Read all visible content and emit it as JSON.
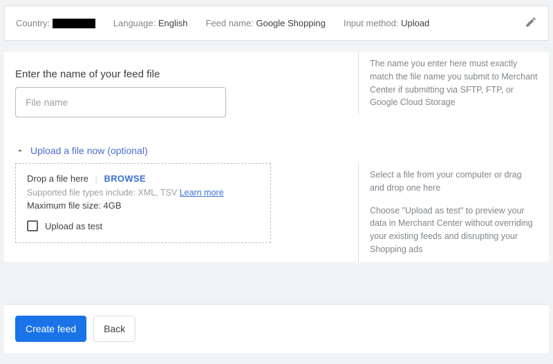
{
  "summary": {
    "country_label": "Country:",
    "language_label": "Language:",
    "language_value": "English",
    "feed_name_label": "Feed name:",
    "feed_name_value": "Google Shopping",
    "input_method_label": "Input method:",
    "input_method_value": "Upload"
  },
  "feedfile": {
    "title": "Enter the name of your feed file",
    "placeholder": "File name",
    "value": "",
    "help": "The name you enter here must exactly match the file name you submit to Merchant Center if submitting via SFTP, FTP, or Google Cloud Storage"
  },
  "upload": {
    "toggle_label": "Upload a file now (optional)",
    "drop_label": "Drop a file here",
    "browse_label": "BROWSE",
    "supported_prefix": "Supported file types include: XML, TSV",
    "learn_more": "Learn more",
    "max_size": "Maximum file size: 4GB",
    "upload_as_test": "Upload as test",
    "help1": "Select a file from your computer or drag and drop one here",
    "help2": "Choose \"Upload as test\" to preview your data in Merchant Center without overriding your existing feeds and disrupting your Shopping ads"
  },
  "footer": {
    "create": "Create feed",
    "back": "Back"
  }
}
